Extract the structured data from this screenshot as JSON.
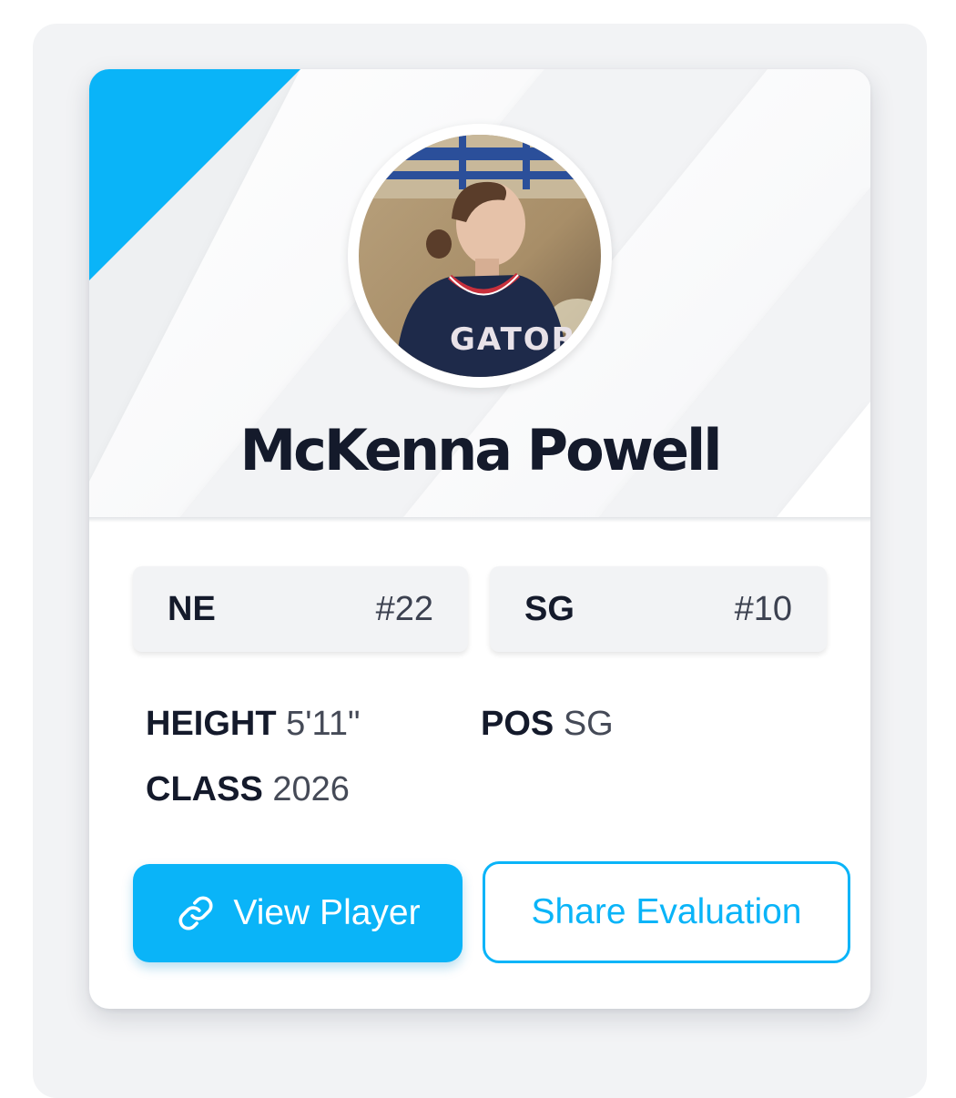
{
  "player": {
    "name": "McKenna Powell",
    "avatar_alt": "player-photo"
  },
  "badges": [
    {
      "label": "NE",
      "rank": "#22"
    },
    {
      "label": "SG",
      "rank": "#10"
    }
  ],
  "stats": {
    "height": {
      "key": "HEIGHT",
      "value": "5'11\""
    },
    "position": {
      "key": "POS",
      "value": "SG"
    },
    "class": {
      "key": "CLASS",
      "value": "2026"
    }
  },
  "actions": {
    "view_player_label": "View Player",
    "view_player_icon": "link-icon",
    "share_label": "Share Evaluation"
  },
  "colors": {
    "accent": "#0ab4f8",
    "name_text": "#141a2b",
    "panel_bg": "#f2f3f5"
  }
}
